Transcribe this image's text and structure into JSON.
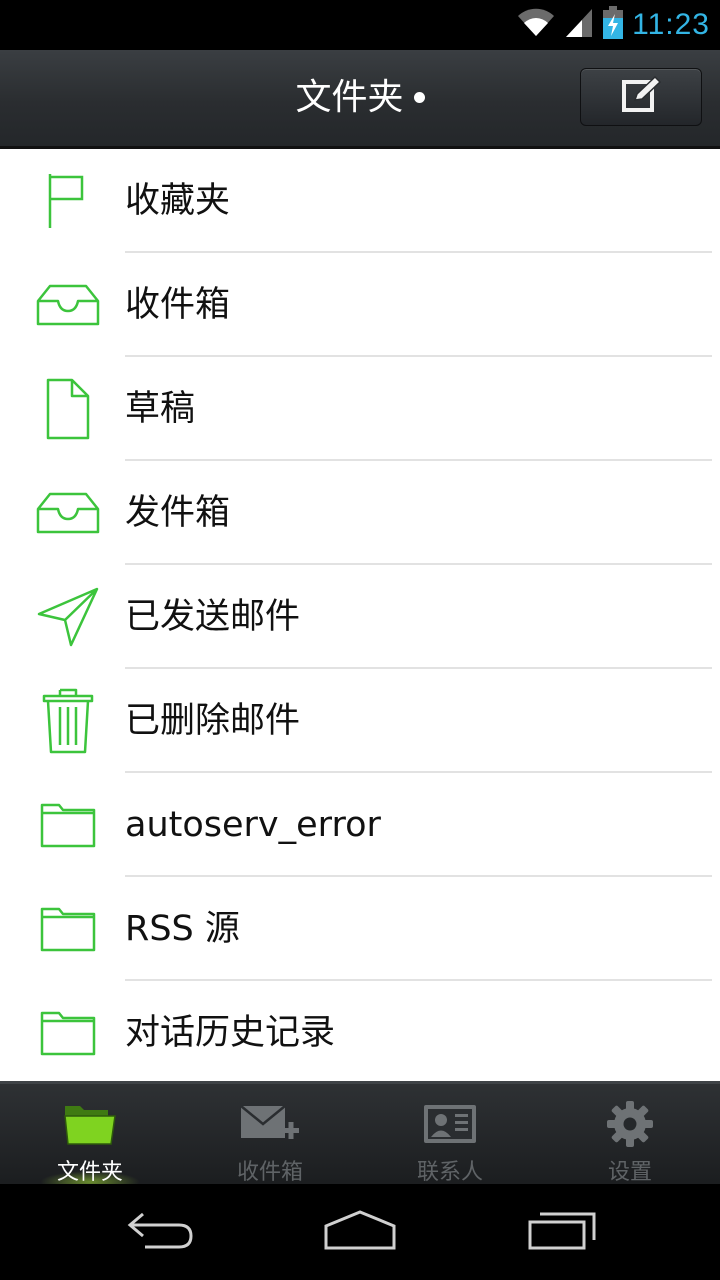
{
  "status_bar": {
    "time": "11:23",
    "icons": [
      "wifi-icon",
      "signal-icon",
      "battery-charging-icon"
    ]
  },
  "header": {
    "title": "文件夹",
    "compose_icon": "compose-icon"
  },
  "folders": [
    {
      "label": "收藏夹",
      "icon": "flag-icon"
    },
    {
      "label": "收件箱",
      "icon": "inbox-tray-icon"
    },
    {
      "label": "草稿",
      "icon": "draft-document-icon"
    },
    {
      "label": "发件箱",
      "icon": "outbox-tray-icon"
    },
    {
      "label": "已发送邮件",
      "icon": "paper-plane-icon"
    },
    {
      "label": "已删除邮件",
      "icon": "trash-icon"
    },
    {
      "label": "autoserv_error",
      "icon": "folder-icon"
    },
    {
      "label": "RSS 源",
      "icon": "folder-icon"
    },
    {
      "label": "对话历史记录",
      "icon": "folder-icon"
    }
  ],
  "tabs": [
    {
      "label": "文件夹",
      "icon": "folder-open-icon",
      "active": true
    },
    {
      "label": "收件箱",
      "icon": "mail-add-icon",
      "active": false
    },
    {
      "label": "联系人",
      "icon": "contact-card-icon",
      "active": false
    },
    {
      "label": "设置",
      "icon": "gear-icon",
      "active": false
    }
  ],
  "nav": [
    "back-icon",
    "home-icon",
    "recents-icon"
  ],
  "colors": {
    "accent_green": "#3cc43c",
    "status_blue": "#33b5e5",
    "tab_active_green": "#7fd320"
  }
}
